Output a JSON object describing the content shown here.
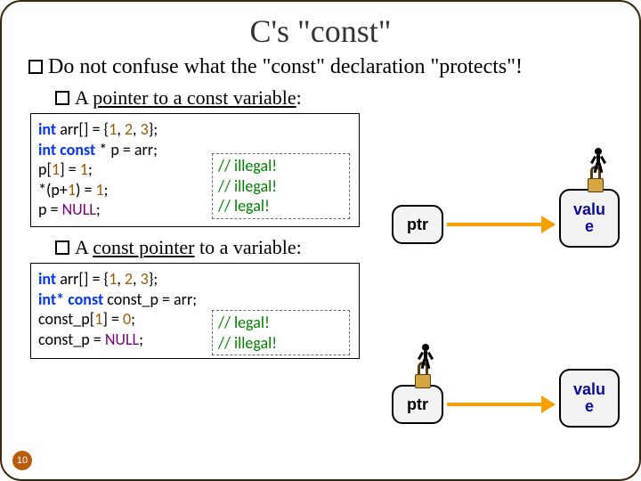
{
  "title": "C's  \"const\"",
  "bullets": {
    "main": "Do not confuse what the \"const\" declaration \"protects\"!",
    "sub1_pre": "A ",
    "sub1_mid": "pointer to a const variable",
    "sub1_post": ":",
    "sub2_pre": "A ",
    "sub2_mid": "const pointer",
    "sub2_post": " to a variable:"
  },
  "code1": {
    "kw_int1": "int",
    "t1": " arr[] = {",
    "n1": "1",
    "c1": ", ",
    "n2": "2",
    "c2": ", ",
    "n3": "3",
    "t1b": "};",
    "kw_int2": "int const",
    "t2": " * p = arr;",
    "l3": "p[",
    "n4": "1",
    "l3b": "] = ",
    "n5": "1",
    "l3c": ";",
    "l4a": "*(p+",
    "n6": "1",
    "l4b": ") = ",
    "n7": "1",
    "l4c": ";",
    "l5a": "p = ",
    "nul": "NULL",
    "l5b": ";"
  },
  "comments1": {
    "c1": "// illegal!",
    "c2": "// illegal!",
    "c3": "// legal!"
  },
  "code2": {
    "kw_int1": "int",
    "t1": " arr[] = {",
    "n1": "1",
    "c1": ", ",
    "n2": "2",
    "c2": ", ",
    "n3": "3",
    "t1b": "};",
    "kw_int2": "int* const",
    "t2": " const_p = arr;",
    "l3": "const_p[",
    "n4": "1",
    "l3b": "] = ",
    "n5": "0",
    "l3c": ";",
    "l4a": "const_p = ",
    "nul": "NULL",
    "l4b": ";"
  },
  "comments2": {
    "c1": "// legal!",
    "c2": "// illegal!"
  },
  "diagram": {
    "ptr": "ptr",
    "val_l1": "valu",
    "val_l2": "e"
  },
  "slide_num": "10"
}
